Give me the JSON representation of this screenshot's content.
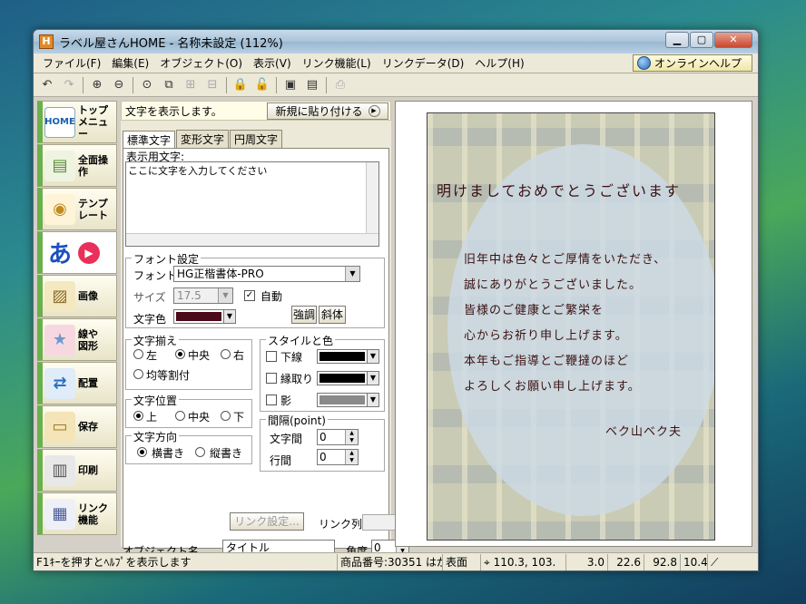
{
  "window": {
    "title": "ラベル屋さんHOME - 名称未設定 (112%)",
    "app_icon": "H"
  },
  "menu": [
    "ファイル(F)",
    "編集(E)",
    "オブジェクト(O)",
    "表示(V)",
    "リンク機能(L)",
    "リンクデータ(D)",
    "ヘルプ(H)"
  ],
  "online_help": "オンラインヘルプ",
  "sidebar": [
    {
      "label": "トップメニュー",
      "icon": "HOME"
    },
    {
      "label": "全面操作",
      "icon": "▤"
    },
    {
      "label": "テンプレート",
      "icon": "◉"
    },
    {
      "label": "",
      "icon": "あ"
    },
    {
      "label": "画像",
      "icon": "▨"
    },
    {
      "label": "線や図形",
      "icon": "★"
    },
    {
      "label": "配置",
      "icon": "⇄"
    },
    {
      "label": "保存",
      "icon": "▭"
    },
    {
      "label": "印刷",
      "icon": "▥"
    },
    {
      "label": "リンク機能",
      "icon": "▦"
    }
  ],
  "panel": {
    "info": "文字を表示します。",
    "paste_button": "新規に貼り付ける",
    "tabs": [
      "標準文字",
      "変形文字",
      "円周文字"
    ],
    "display_text_label": "表示用文字:",
    "display_text": "ここに文字を入力してください",
    "font_group": "フォント設定",
    "font_label": "フォント",
    "font_value": "HG正楷書体-PRO",
    "size_label": "サイズ",
    "size_value": "17.5",
    "auto_label": "自動",
    "color_label": "文字色",
    "bold_button": "強調",
    "italic_button": "斜体",
    "align_group": "文字揃え",
    "align_left": "左",
    "align_center": "中央",
    "align_right": "右",
    "align_even": "均等割付",
    "pos_group": "文字位置",
    "pos_top": "上",
    "pos_center": "中央",
    "pos_bottom": "下",
    "dir_group": "文字方向",
    "dir_horizontal": "横書き",
    "dir_vertical": "縦書き",
    "style_group": "スタイルと色",
    "underline": "下線",
    "outline": "縁取り",
    "shadow": "影",
    "spacing_group": "間隔(point)",
    "char_spacing_label": "文字間",
    "char_spacing": "0",
    "line_spacing_label": "行間",
    "line_spacing": "0",
    "link_settings": "リンク設定...",
    "link_col_label": "リンク列",
    "object_name_label": "オブジェクト名",
    "object_name": "タイトル",
    "angle_label": "角度",
    "angle": "0"
  },
  "card": {
    "greeting": "明けましておめでとうございます",
    "lines": [
      "旧年中は色々とご厚情をいただき、",
      "誠にありがとうございました。",
      "皆様のご健康とご繁栄を",
      "心からお祈り申し上げます。",
      "本年もご指導とご鞭撻のほど",
      "よろしくお願い申し上げます。"
    ],
    "signature": "ベク山ベク夫"
  },
  "status": {
    "hint": "F1ｷｰを押すとﾍﾙﾌﾟを表示します",
    "product": "商品番号:30351 はが",
    "side": "表面",
    "coords": "110.3, 103.",
    "v1": "3.0",
    "v2": "22.6",
    "v3": "92.8",
    "v4": "10.4"
  },
  "colors": {
    "text_color": "#4a0a1a",
    "style_underline": "#000000",
    "style_outline": "#000000",
    "style_shadow": "#8a8a8a"
  }
}
